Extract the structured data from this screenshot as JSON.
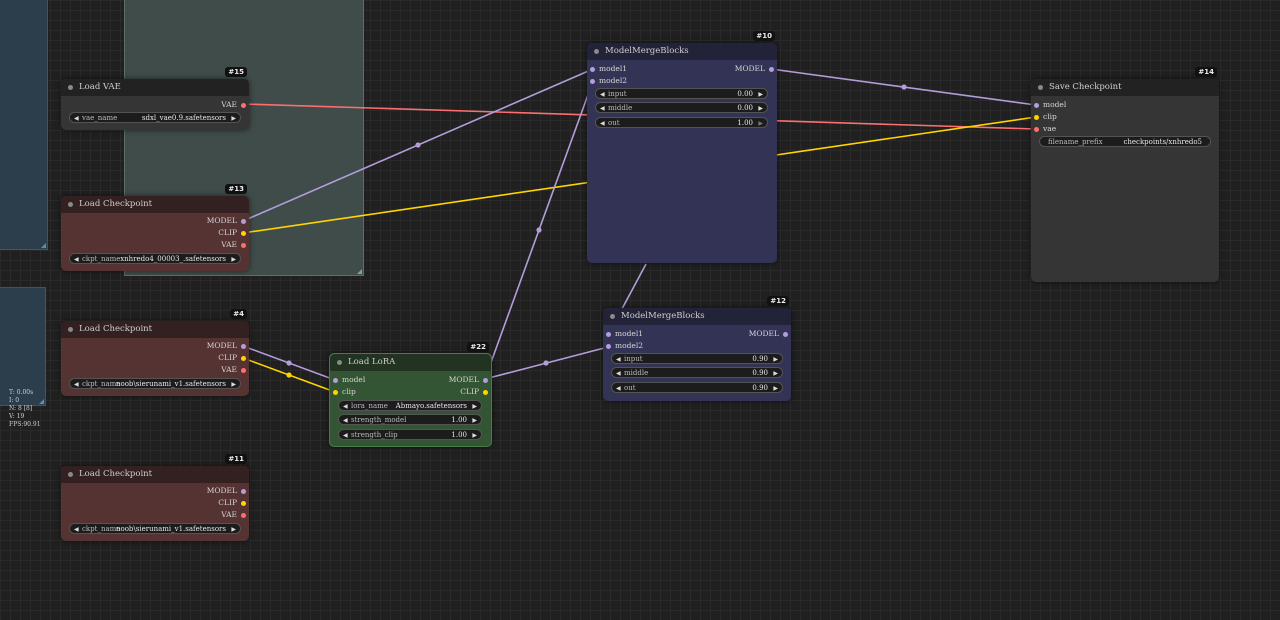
{
  "stats": {
    "line1": "T: 0.00s",
    "line2": "I: 0",
    "line3": "N: 8 [8]",
    "line4": "V: 19",
    "line5": "FPS:90.91"
  },
  "colors": {
    "model_wire": "#b39ddb",
    "clip_wire": "#ffd500",
    "vae_wire": "#ff6e6e"
  },
  "nodes": {
    "n15": {
      "id": "#15",
      "title": "Load VAE",
      "outputs": {
        "vae": "VAE"
      },
      "widgets": {
        "vae_name": {
          "label": "vae_name",
          "value": "sdxl_vae0.9.safetensors"
        }
      }
    },
    "n13": {
      "id": "#13",
      "title": "Load Checkpoint",
      "outputs": {
        "model": "MODEL",
        "clip": "CLIP",
        "vae": "VAE"
      },
      "widgets": {
        "ckpt_name": {
          "label": "ckpt_name",
          "value": "xnhredo4_00003_.safetensors"
        }
      }
    },
    "n4": {
      "id": "#4",
      "title": "Load Checkpoint",
      "outputs": {
        "model": "MODEL",
        "clip": "CLIP",
        "vae": "VAE"
      },
      "widgets": {
        "ckpt_name": {
          "label": "ckpt_name",
          "value": "noob\\sierunami_v1.safetensors"
        }
      }
    },
    "n11": {
      "id": "#11",
      "title": "Load Checkpoint",
      "outputs": {
        "model": "MODEL",
        "clip": "CLIP",
        "vae": "VAE"
      },
      "widgets": {
        "ckpt_name": {
          "label": "ckpt_name",
          "value": "noob\\sierunami_v1.safetensors"
        }
      }
    },
    "n22": {
      "id": "#22",
      "title": "Load LoRA",
      "inputs": {
        "model": "model",
        "clip": "clip"
      },
      "outputs": {
        "model": "MODEL",
        "clip": "CLIP"
      },
      "widgets": {
        "lora_name": {
          "label": "lora_name",
          "value": "Abmayo.safetensors"
        },
        "strength_model": {
          "label": "strength_model",
          "value": "1.00"
        },
        "strength_clip": {
          "label": "strength_clip",
          "value": "1.00"
        }
      }
    },
    "n10": {
      "id": "#10",
      "title": "ModelMergeBlocks",
      "inputs": {
        "model1": "model1",
        "model2": "model2"
      },
      "outputs": {
        "model": "MODEL"
      },
      "widgets": {
        "input": {
          "label": "input",
          "value": "0.00"
        },
        "middle": {
          "label": "middle",
          "value": "0.00"
        },
        "out": {
          "label": "out",
          "value": "1.00"
        }
      }
    },
    "n12": {
      "id": "#12",
      "title": "ModelMergeBlocks",
      "inputs": {
        "model1": "model1",
        "model2": "model2"
      },
      "outputs": {
        "model": "MODEL"
      },
      "widgets": {
        "input": {
          "label": "input",
          "value": "0.90"
        },
        "middle": {
          "label": "middle",
          "value": "0.90"
        },
        "out": {
          "label": "out",
          "value": "0.90"
        }
      }
    },
    "n14": {
      "id": "#14",
      "title": "Save Checkpoint",
      "inputs": {
        "model": "model",
        "clip": "clip",
        "vae": "vae"
      },
      "widgets": {
        "filename_prefix": {
          "label": "filename_prefix",
          "value": "checkpoints/xnhredo5"
        }
      }
    }
  }
}
